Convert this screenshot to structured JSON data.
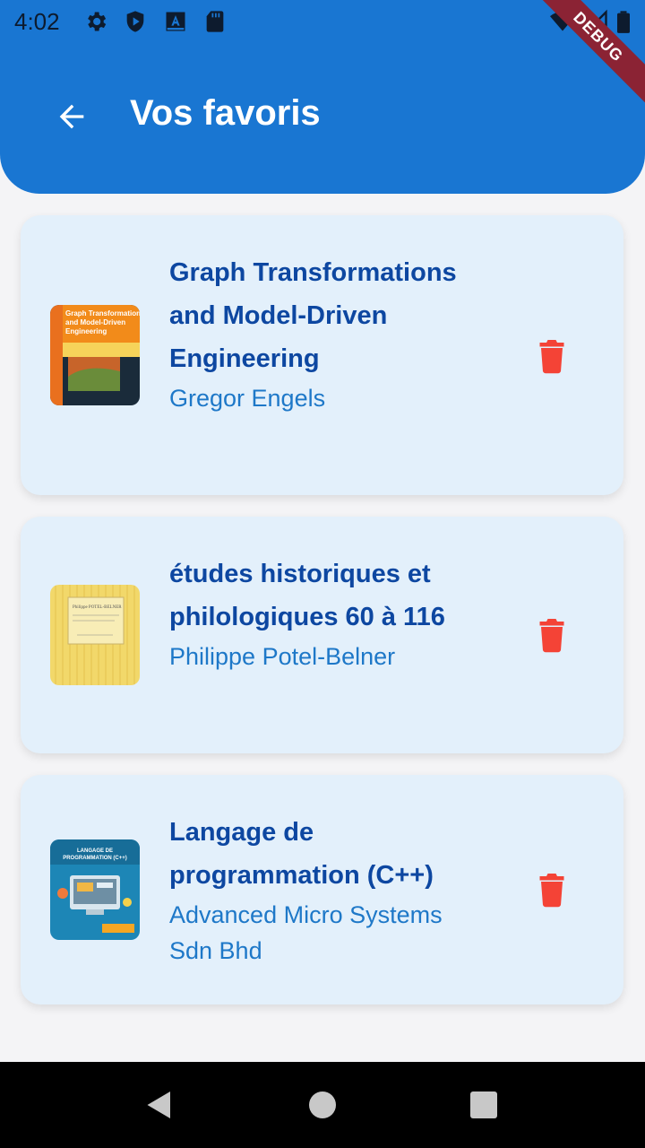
{
  "status": {
    "time": "4:02"
  },
  "header": {
    "title": "Vos favoris",
    "debug_banner": "DEBUG"
  },
  "favorites": [
    {
      "title": "Graph Transformations and Model-Driven Engineering",
      "author": "Gregor Engels",
      "cover_text": "Graph Transformations and Model-Driven Engineering"
    },
    {
      "title": "études historiques et philologiques 60 à 116",
      "author": "Philippe Potel-Belner",
      "cover_text": "Philippe POTEL-BELNER"
    },
    {
      "title": "Langage de programmation (C++)",
      "author": "Advanced Micro Systems Sdn Bhd",
      "cover_text": "LANGAGE DE PROGRAMMATION (C++)"
    }
  ],
  "colors": {
    "appbar": "#1976d2",
    "card": "#e3f0fb",
    "title": "#0d47a1",
    "author": "#1e78c8",
    "delete": "#f44336"
  }
}
